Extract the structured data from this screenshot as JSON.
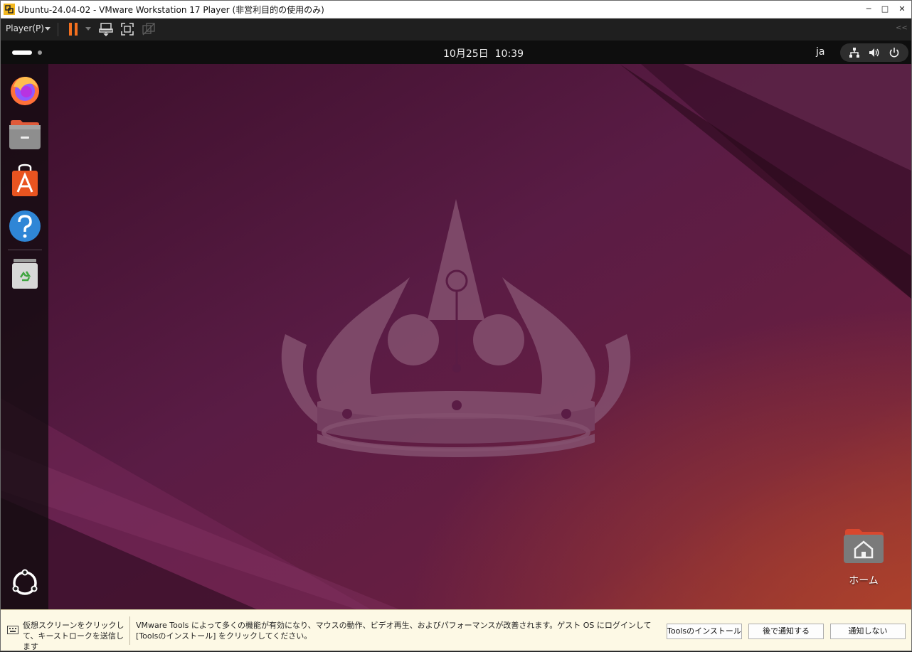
{
  "window": {
    "title": "Ubuntu-24.04-02 - VMware Workstation 17 Player (非営利目的の使用のみ)",
    "controls": {
      "minimize": "─",
      "maximize": "□",
      "close": "✕"
    }
  },
  "toolbar": {
    "player_menu": "Player(P)",
    "collapse_glyph": "<<"
  },
  "guest": {
    "top_bar": {
      "date": "10月25日",
      "time": "10:39",
      "input_method": "ja"
    },
    "dock": {
      "items": [
        "firefox-icon",
        "files-icon",
        "app-center-icon",
        "help-icon",
        "trash-icon",
        "show-apps-icon"
      ]
    },
    "desktop": {
      "home_label": "ホーム"
    },
    "colors": {
      "wallpaper_dark": "#3a1029",
      "wallpaper_mid": "#5c1c45",
      "wallpaper_warm": "#8a2e33",
      "crown": "#84506f",
      "accent_orange": "#f4701f"
    }
  },
  "notification": {
    "hint": "仮想スクリーンをクリックして、キーストロークを送信します",
    "message": "VMware Tools によって多くの機能が有効になり、マウスの動作、ビデオ再生、およびパフォーマンスが改善されます。ゲスト OS にログインして [Toolsのインストール] をクリックしてください。",
    "buttons": {
      "install": "Toolsのインストール",
      "remind_later": "後で通知する",
      "never": "通知しない"
    }
  }
}
